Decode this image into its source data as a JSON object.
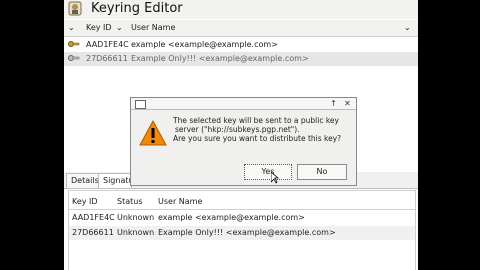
{
  "window": {
    "title": "Keyring Editor"
  },
  "key_list": {
    "columns": [
      "Key ID",
      "User Name"
    ],
    "rows": [
      {
        "key_id": "AAD1FE4C",
        "user_name": "example <example@example.com>",
        "selected": false
      },
      {
        "key_id": "27D66611",
        "user_name": "Example Only!!! <example@example.com>",
        "selected": true
      }
    ]
  },
  "tabs": [
    "Details",
    "Signatu"
  ],
  "signatures": {
    "columns": [
      "Key ID",
      "Status",
      "User Name"
    ],
    "rows": [
      {
        "key_id": "AAD1FE4C",
        "status": "Unknown",
        "user_name": "example <example@example.com>"
      },
      {
        "key_id": "27D66611",
        "status": "Unknown",
        "user_name": "Example Only!!! <example@example.com>"
      }
    ]
  },
  "dialog": {
    "line1": "The selected key will be sent to a public key",
    "line2": "server (\"hkp://subkeys.pgp.net\").",
    "line3": "Are you sure you want to distribute this key?",
    "yes_label": "Yes",
    "no_label": "No",
    "warning_icon": "warning-icon"
  },
  "colors": {
    "warning": "#f08a00",
    "selected_row": "#e6e6e6"
  }
}
